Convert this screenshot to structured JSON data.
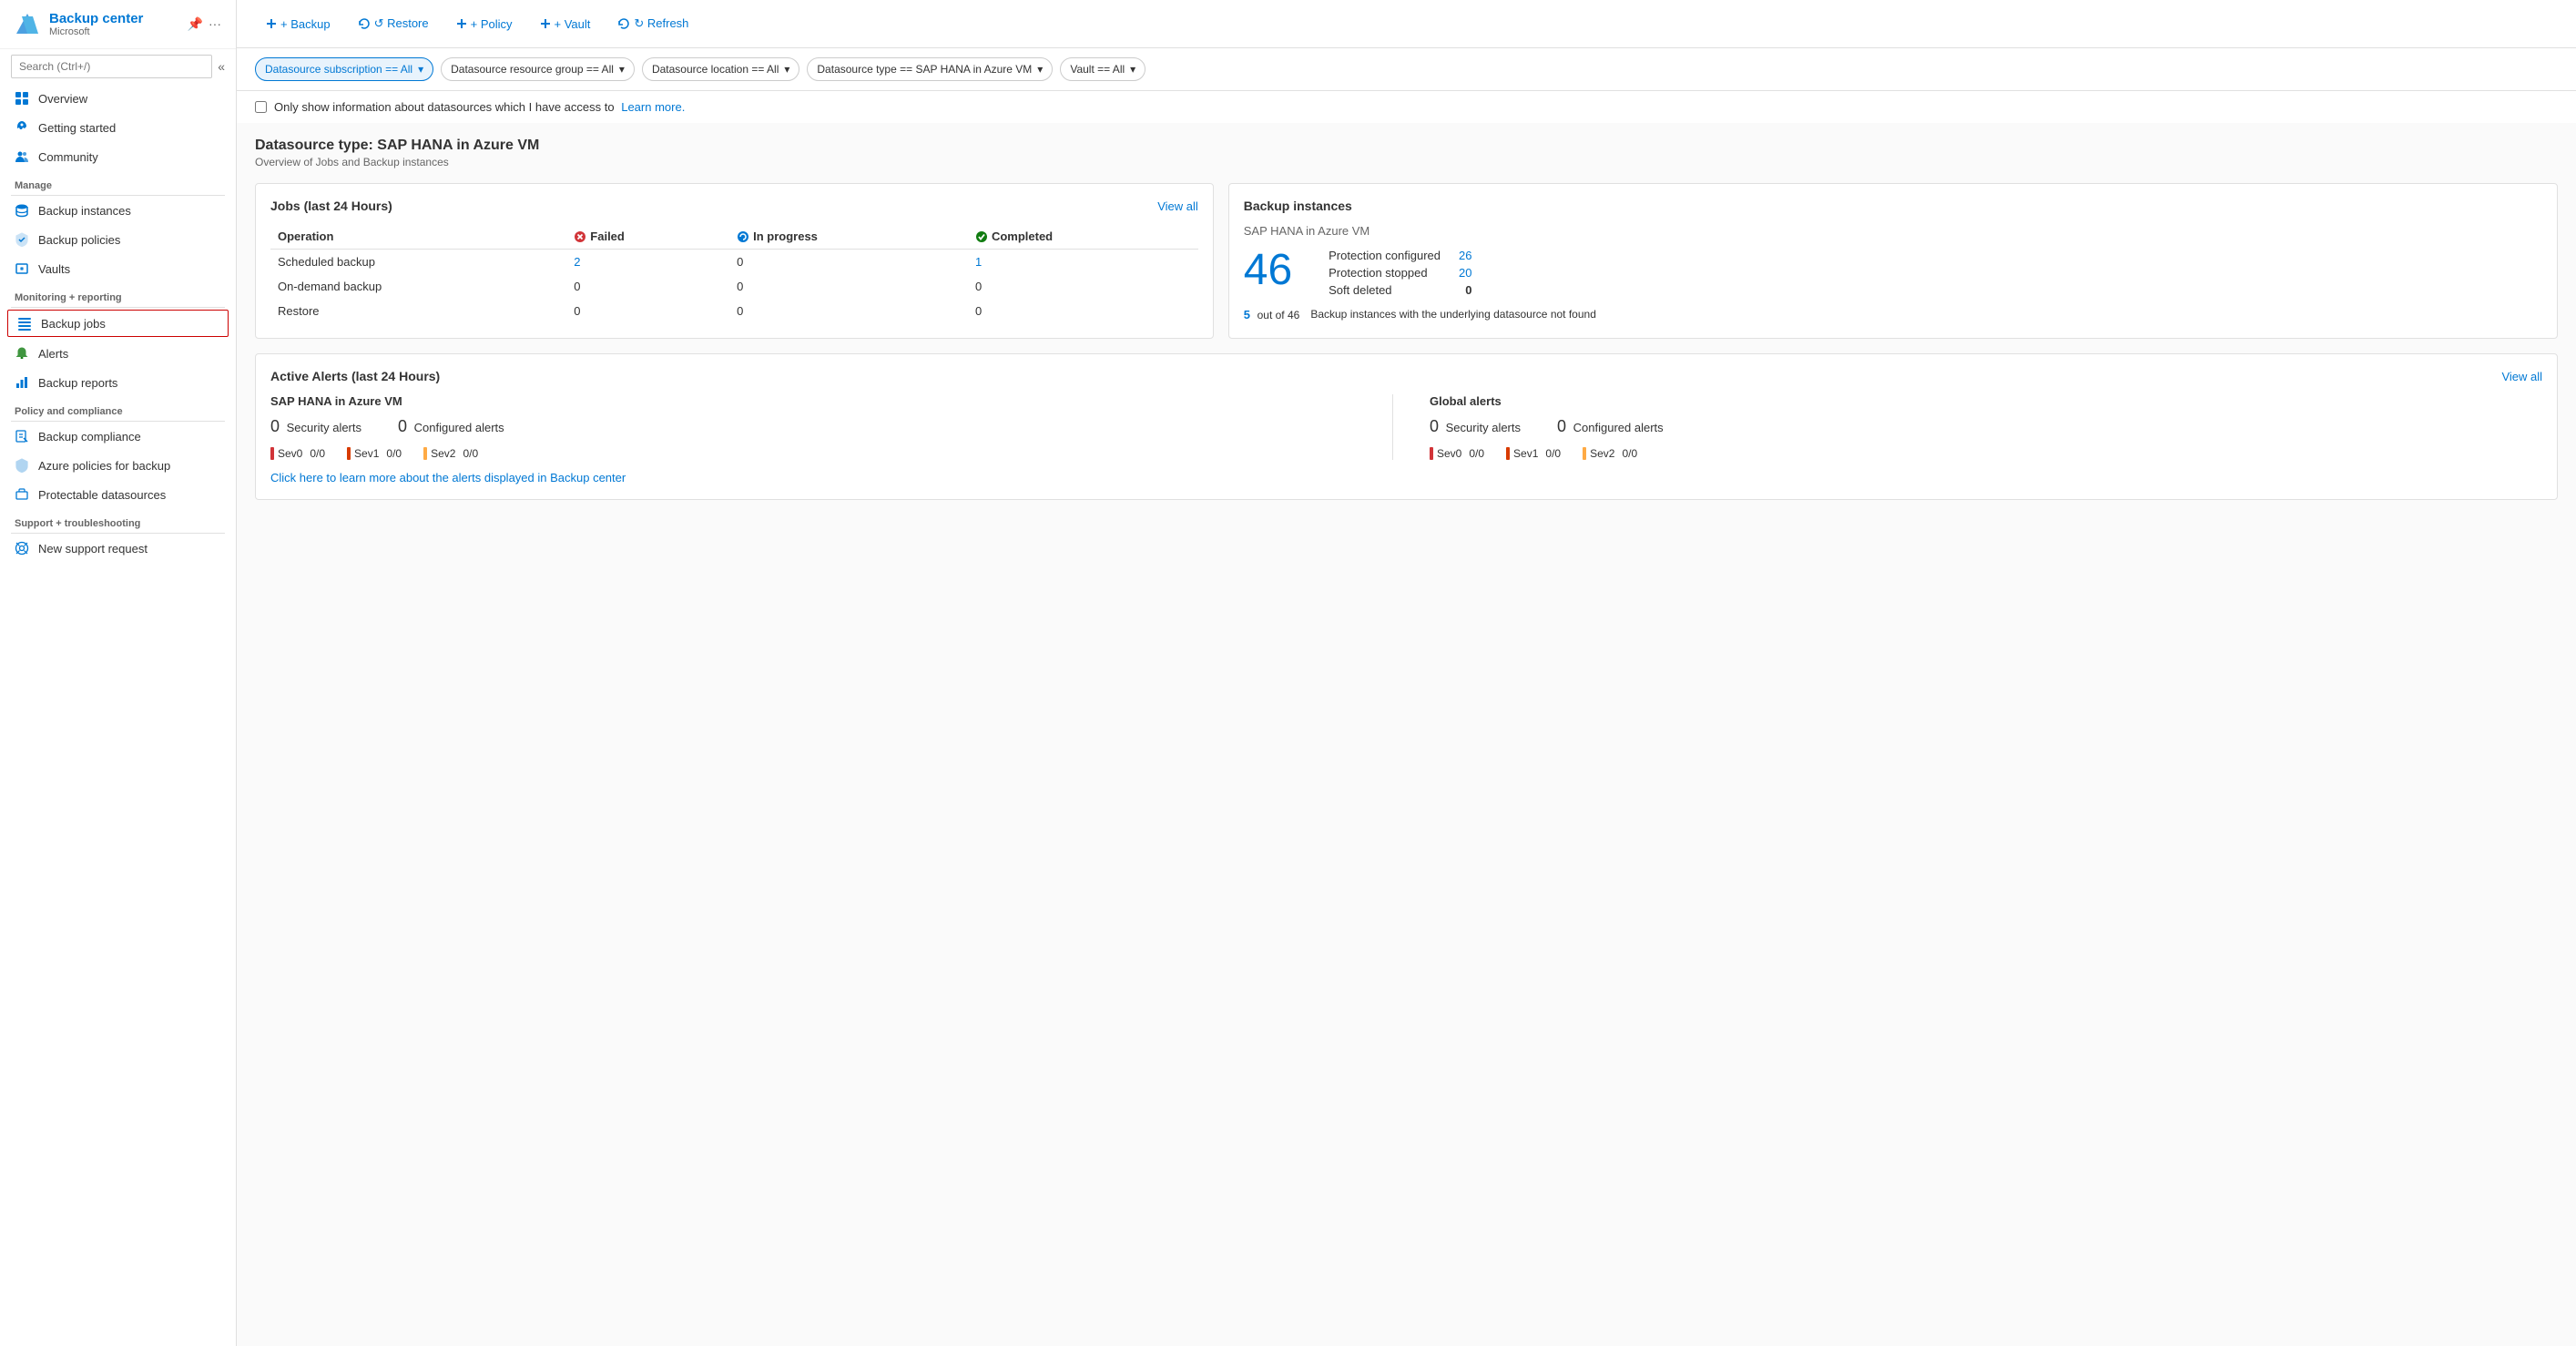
{
  "sidebar": {
    "app_title": "Backup center",
    "app_subtitle": "Microsoft",
    "search_placeholder": "Search (Ctrl+/)",
    "nav_items": [
      {
        "id": "overview",
        "label": "Overview",
        "icon": "grid",
        "active": false
      },
      {
        "id": "getting-started",
        "label": "Getting started",
        "icon": "rocket",
        "active": false
      },
      {
        "id": "community",
        "label": "Community",
        "icon": "people",
        "active": false
      }
    ],
    "manage_label": "Manage",
    "manage_items": [
      {
        "id": "backup-instances",
        "label": "Backup instances",
        "icon": "database"
      },
      {
        "id": "backup-policies",
        "label": "Backup policies",
        "icon": "shield"
      },
      {
        "id": "vaults",
        "label": "Vaults",
        "icon": "vault"
      }
    ],
    "monitoring_label": "Monitoring + reporting",
    "monitoring_items": [
      {
        "id": "backup-jobs",
        "label": "Backup jobs",
        "icon": "list",
        "selected": true
      },
      {
        "id": "alerts",
        "label": "Alerts",
        "icon": "bell"
      },
      {
        "id": "backup-reports",
        "label": "Backup reports",
        "icon": "chart"
      }
    ],
    "policy_label": "Policy and compliance",
    "policy_items": [
      {
        "id": "backup-compliance",
        "label": "Backup compliance",
        "icon": "compliance"
      },
      {
        "id": "azure-policies",
        "label": "Azure policies for backup",
        "icon": "policy"
      },
      {
        "id": "protectable",
        "label": "Protectable datasources",
        "icon": "datasource"
      }
    ],
    "support_label": "Support + troubleshooting",
    "support_items": [
      {
        "id": "new-support",
        "label": "New support request",
        "icon": "support"
      }
    ]
  },
  "toolbar": {
    "backup_label": "+ Backup",
    "restore_label": "↺ Restore",
    "policy_label": "+ Policy",
    "vault_label": "+ Vault",
    "refresh_label": "↻ Refresh"
  },
  "filters": {
    "subscription": "Datasource subscription == All",
    "resource_group": "Datasource resource group == All",
    "location": "Datasource location == All",
    "type": "Datasource type == SAP HANA in Azure VM",
    "vault": "Vault == All"
  },
  "access_check": {
    "label": "Only show information about datasources which I have access to",
    "link_text": "Learn more."
  },
  "main": {
    "datasource_title": "Datasource type: SAP HANA in Azure VM",
    "datasource_subtitle": "Overview of Jobs and Backup instances",
    "jobs_section": {
      "title": "Jobs (last 24 Hours)",
      "view_all": "View all",
      "columns": [
        "Operation",
        "Failed",
        "In progress",
        "Completed"
      ],
      "rows": [
        {
          "operation": "Scheduled backup",
          "failed": "2",
          "failed_is_link": true,
          "in_progress": "0",
          "completed": "1",
          "completed_is_link": true
        },
        {
          "operation": "On-demand backup",
          "failed": "0",
          "in_progress": "0",
          "completed": "0"
        },
        {
          "operation": "Restore",
          "failed": "0",
          "in_progress": "0",
          "completed": "0"
        }
      ]
    },
    "backup_instances_section": {
      "title": "Backup instances",
      "subtitle": "SAP HANA in Azure VM",
      "total": "46",
      "protection_configured_label": "Protection configured",
      "protection_configured_val": "26",
      "protection_stopped_label": "Protection stopped",
      "protection_stopped_val": "20",
      "soft_deleted_label": "Soft deleted",
      "soft_deleted_val": "0",
      "footer_num": "5",
      "footer_denom": "out of 46",
      "footer_desc": "Backup instances with the underlying datasource not found"
    },
    "alerts_section": {
      "title": "Active Alerts (last 24 Hours)",
      "view_all": "View all",
      "sap_hana_title": "SAP HANA in Azure VM",
      "security_alerts_count": "0",
      "security_alerts_label": "Security alerts",
      "configured_alerts_count": "0",
      "configured_alerts_label": "Configured alerts",
      "sev0_label": "Sev0",
      "sev0_val": "0/0",
      "sev1_label": "Sev1",
      "sev1_val": "0/0",
      "sev2_label": "Sev2",
      "sev2_val": "0/0",
      "global_title": "Global alerts",
      "global_security_count": "0",
      "global_security_label": "Security alerts",
      "global_configured_count": "0",
      "global_configured_label": "Configured alerts",
      "global_sev0_val": "0/0",
      "global_sev1_val": "0/0",
      "global_sev2_val": "0/0",
      "footer_link": "Click here to learn more about the alerts displayed in Backup center"
    }
  }
}
